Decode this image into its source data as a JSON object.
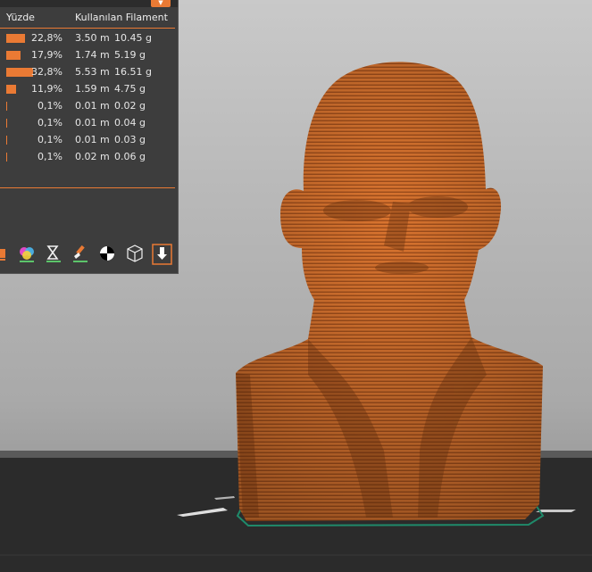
{
  "panel": {
    "headers": {
      "percent": "Yüzde",
      "used_filament": "Kullanılan Filament"
    },
    "rows": [
      {
        "percent": "22,8%",
        "length": "3.50 m",
        "weight": "10.45 g",
        "fraction": 0.228
      },
      {
        "percent": "17,9%",
        "length": "1.74 m",
        "weight": "5.19 g",
        "fraction": 0.179
      },
      {
        "percent": "32,8%",
        "length": "5.53 m",
        "weight": "16.51 g",
        "fraction": 0.328
      },
      {
        "percent": "11,9%",
        "length": "1.59 m",
        "weight": "4.75 g",
        "fraction": 0.119
      },
      {
        "percent": "0,1%",
        "length": "0.01 m",
        "weight": "0.02 g",
        "fraction": 0.001
      },
      {
        "percent": "0,1%",
        "length": "0.01 m",
        "weight": "0.04 g",
        "fraction": 0.001
      },
      {
        "percent": "0,1%",
        "length": "0.01 m",
        "weight": "0.03 g",
        "fraction": 0.001
      },
      {
        "percent": "0,1%",
        "length": "0.02 m",
        "weight": "0.06 g",
        "fraction": 0.001
      }
    ],
    "toolbar": [
      {
        "name": "color-print-icon"
      },
      {
        "name": "color-palette-icon"
      },
      {
        "name": "hourglass-icon"
      },
      {
        "name": "paint-brush-icon"
      },
      {
        "name": "contrast-circle-icon"
      },
      {
        "name": "wireframe-cube-icon"
      },
      {
        "name": "export-download-icon"
      }
    ]
  },
  "colors": {
    "accent": "#ea7a34",
    "model": "#d9742f",
    "panel_bg": "#3d3d3d",
    "bed": "#2b2b2b",
    "outline": "#1f8a6a"
  }
}
